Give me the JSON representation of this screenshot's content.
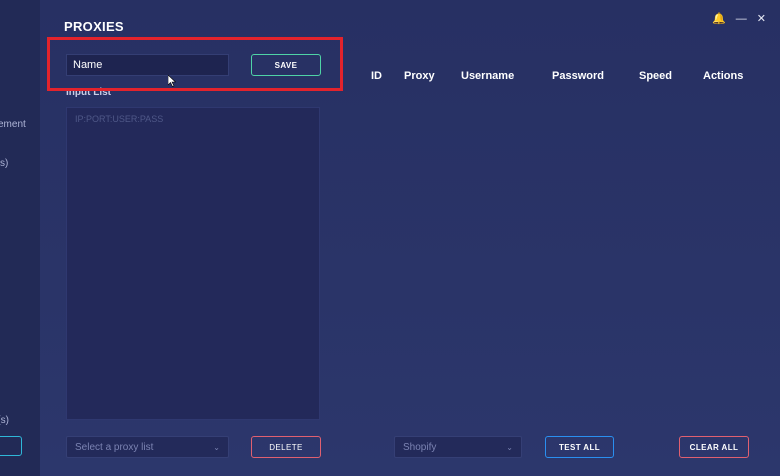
{
  "app": {
    "title": "PROXIES"
  },
  "window_controls": {
    "bell": "🔔",
    "minimize": "—",
    "close": "✕"
  },
  "sidebar": {
    "items": [
      {
        "label": "ement"
      },
      {
        "label": "s)"
      },
      {
        "label": "r(s)"
      }
    ]
  },
  "form": {
    "name_placeholder": "Name",
    "save_label": "SAVE"
  },
  "input_list": {
    "label": "Input List",
    "placeholder": "IP:PORT:USER:PASS"
  },
  "table": {
    "columns": [
      "ID",
      "Proxy",
      "Username",
      "Password",
      "Speed",
      "Actions"
    ],
    "rows": []
  },
  "footer": {
    "proxy_list_placeholder": "Select a proxy list",
    "delete_label": "DELETE",
    "site_value": "Shopify",
    "test_all_label": "TEST ALL",
    "clear_all_label": "CLEAR ALL"
  },
  "colors": {
    "save_border": "#4fd3a6",
    "delete_border": "#e06070",
    "test_border": "#2a8ff0",
    "highlight": "#e3232c"
  }
}
